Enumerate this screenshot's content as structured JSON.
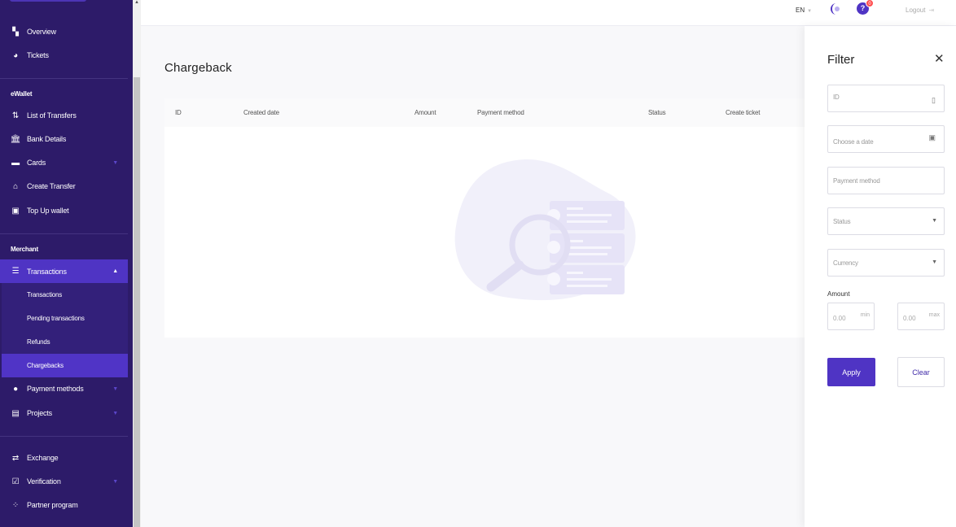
{
  "sidebar": {
    "items_top": [
      {
        "label": "Overview",
        "icon": "dashboard-icon"
      },
      {
        "label": "Tickets",
        "icon": "tickets-icon"
      }
    ],
    "section_ewallet": "eWallet",
    "ewallet_items": [
      {
        "label": "List of Transfers",
        "icon": "transfers-icon"
      },
      {
        "label": "Bank Details",
        "icon": "bank-icon"
      },
      {
        "label": "Cards",
        "icon": "card-icon"
      },
      {
        "label": "Create Transfer",
        "icon": "create-transfer-icon"
      },
      {
        "label": "Top Up wallet",
        "icon": "wallet-icon"
      }
    ],
    "section_merchant": "Merchant",
    "transactions": {
      "label": "Transactions",
      "icon": "list-icon"
    },
    "transactions_sub": [
      "Transactions",
      "Pending transactions",
      "Refunds",
      "Chargebacks"
    ],
    "merchant_items": [
      {
        "label": "Payment methods",
        "icon": "payment-methods-icon"
      },
      {
        "label": "Projects",
        "icon": "projects-icon"
      }
    ],
    "bottom_items": [
      {
        "label": "Exchange",
        "icon": "exchange-icon"
      },
      {
        "label": "Verification",
        "icon": "verification-icon"
      },
      {
        "label": "Partner program",
        "icon": "partner-icon"
      }
    ]
  },
  "topbar": {
    "language": "EN",
    "notification_count": "0",
    "logout": "Logout"
  },
  "main": {
    "title": "Chargeback",
    "columns": [
      "ID",
      "Created date",
      "Amount",
      "Payment method",
      "Status",
      "Create ticket"
    ]
  },
  "filter": {
    "title": "Filter",
    "id_placeholder": "ID",
    "date_placeholder": "Choose a date",
    "payment_method_placeholder": "Payment method",
    "status_placeholder": "Status",
    "currency_placeholder": "Currency",
    "amount_label": "Amount",
    "min_value": "0.00",
    "min_suffix": "min",
    "max_value": "0.00",
    "max_suffix": "max",
    "apply_label": "Apply",
    "clear_label": "Clear"
  },
  "colors": {
    "sidebar": "#2d1b69",
    "accent": "#4f34c4",
    "active_sub": "#5034c6"
  }
}
